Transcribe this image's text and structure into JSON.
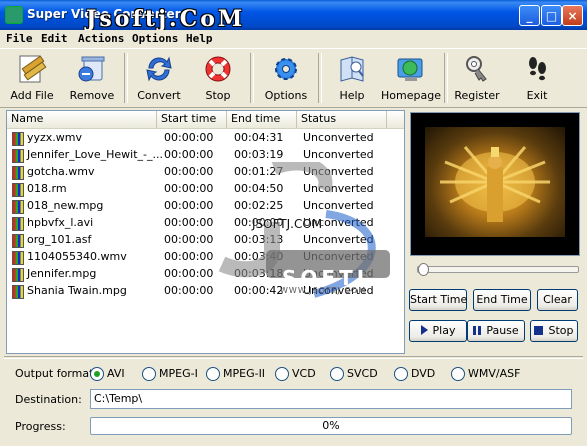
{
  "window": {
    "title": "Super Video Converter",
    "watermark_top": "Jsoftj.CoM",
    "buttons": {
      "minimize": "_",
      "maximize": "□",
      "close": "×"
    }
  },
  "menu": [
    "File",
    "Edit",
    "Actions",
    "Options",
    "Help"
  ],
  "toolbar": {
    "items": [
      {
        "label": "Add File",
        "icon": "film-add-icon"
      },
      {
        "label": "Remove",
        "icon": "remove-icon"
      },
      {
        "label": "Convert",
        "icon": "convert-arrows-icon"
      },
      {
        "label": "Stop",
        "icon": "lifebuoy-stop-icon"
      },
      {
        "label": "Options",
        "icon": "gear-icon"
      },
      {
        "label": "Help",
        "icon": "help-book-icon"
      },
      {
        "label": "Homepage",
        "icon": "globe-icon"
      },
      {
        "label": "Register",
        "icon": "key-icon"
      },
      {
        "label": "Exit",
        "icon": "footprints-icon"
      }
    ]
  },
  "filelist": {
    "columns": [
      "Name",
      "Start time",
      "End time",
      "Status"
    ],
    "rows": [
      {
        "name": "yyzx.wmv",
        "start": "00:00:00",
        "end": "00:04:31",
        "status": "Unconverted"
      },
      {
        "name": "Jennifer_Love_Hewit_-_...",
        "start": "00:00:00",
        "end": "00:03:19",
        "status": "Unconverted"
      },
      {
        "name": "gotcha.wmv",
        "start": "00:00:00",
        "end": "00:01:27",
        "status": "Unconverted"
      },
      {
        "name": "018.rm",
        "start": "00:00:00",
        "end": "00:04:50",
        "status": "Unconverted"
      },
      {
        "name": "018_new.mpg",
        "start": "00:00:00",
        "end": "00:02:25",
        "status": "Unconverted"
      },
      {
        "name": "hpbvfx_l.avi",
        "start": "00:00:00",
        "end": "00:00:00",
        "status": "Unconverted"
      },
      {
        "name": "org_101.asf",
        "start": "00:00:00",
        "end": "00:03:13",
        "status": "Unconverted"
      },
      {
        "name": "1104055340.wmv",
        "start": "00:00:00",
        "end": "00:03:40",
        "status": "Unconverted"
      },
      {
        "name": "Jennifer.mpg",
        "start": "00:00:00",
        "end": "00:03:18",
        "status": "Unconverted"
      },
      {
        "name": "Shania Twain.mpg",
        "start": "00:00:00",
        "end": "00:00:42",
        "status": "Unconverted"
      }
    ]
  },
  "preview": {
    "overlay": "JSOFTJ.COM",
    "seek_fraction": 0
  },
  "watermark": {
    "brand": "SOFTJ",
    "site": "WWW.JSOFTJ.COM"
  },
  "player": {
    "start_time": "Start Time",
    "end_time": "End Time",
    "clear": "Clear",
    "play": "Play",
    "pause": "Pause",
    "stop": "Stop"
  },
  "output": {
    "label": "Output format:",
    "formats": [
      "AVI",
      "MPEG-I",
      "MPEG-II",
      "VCD",
      "SVCD",
      "DVD",
      "WMV/ASF"
    ],
    "selected": "AVI"
  },
  "destination": {
    "label": "Destination:",
    "value": "C:\\Temp\\"
  },
  "progress": {
    "label": "Progress:",
    "value_text": "0%",
    "fraction": 0
  },
  "colors": {
    "titlebar": "#0055e5",
    "progress_fill": "#2ba02b",
    "selected_radio": "#21a121"
  }
}
